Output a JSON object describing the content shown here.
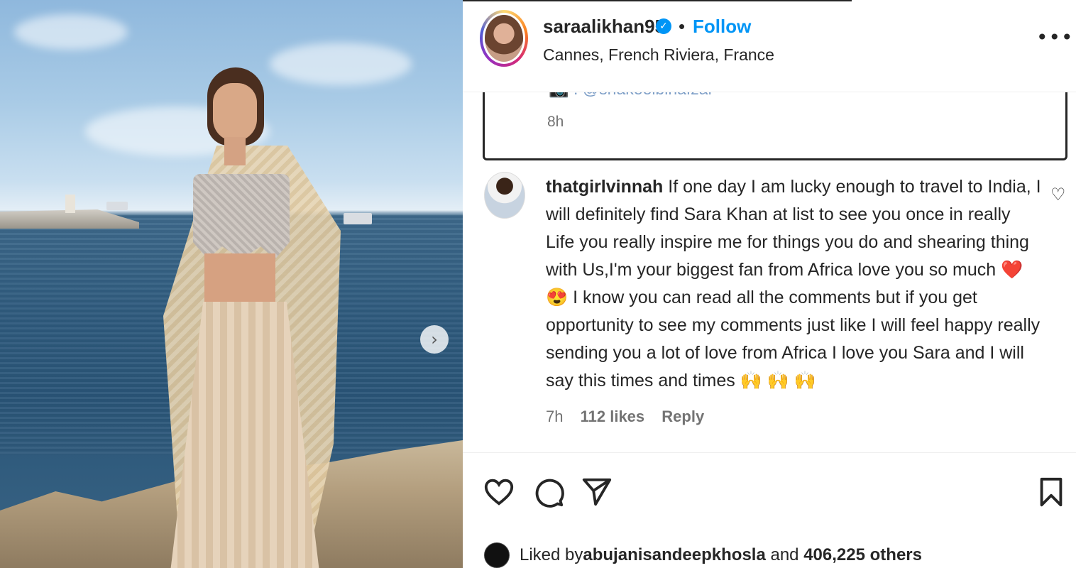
{
  "post": {
    "username": "saraalikhan95",
    "separator": "•",
    "follow_label": "Follow",
    "location": "Cannes, French Riviera, France",
    "more_icon_text": "•••"
  },
  "caption": {
    "faded_text": "📷 : @shakeelbinafzal",
    "time": "8h"
  },
  "comment": {
    "username": "thatgirlvinnah",
    "text": "If one day I am lucky enough to travel to India, I will definitely find Sara Khan at list to see you once in really Life you really inspire me for things you do and shearing thing with Us,I'm your biggest fan from Africa love you so much ❤️ 😍 I know you can read all the comments but if you get opportunity to see my comments just like I will feel happy really sending you a lot of love from Africa I love you Sara and I will say this times and times 🙌 🙌 🙌",
    "time": "7h",
    "likes": "112 likes",
    "reply_label": "Reply"
  },
  "liked_by": {
    "prefix": "Liked by ",
    "user": "abujanisandeepkhosla",
    "middle": " and ",
    "count": "406,225 others"
  },
  "icons": {
    "next": "chevron-right-icon",
    "like": "heart-icon",
    "comment": "comment-icon",
    "share": "send-icon",
    "save": "bookmark-icon",
    "more": "more-icon",
    "verified": "verified-badge-icon",
    "comment_like": "heart-icon"
  },
  "colors": {
    "accent": "#0095f6",
    "text": "#262626",
    "muted": "#737373"
  }
}
